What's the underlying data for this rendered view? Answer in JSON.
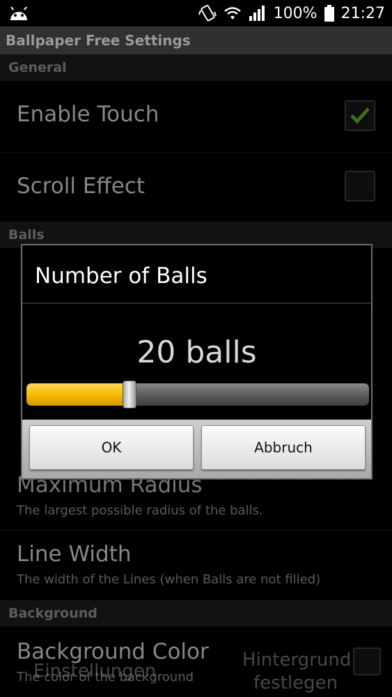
{
  "status_bar": {
    "battery": "100%",
    "time": "21:27"
  },
  "title_bar": {
    "title": "Ballpaper Free Settings"
  },
  "sections": {
    "general": "General",
    "balls": "Balls",
    "background": "Background"
  },
  "settings": {
    "enable_touch": {
      "title": "Enable Touch",
      "checked": true
    },
    "scroll_effect": {
      "title": "Scroll Effect",
      "checked": false
    },
    "maximum_radius": {
      "title": "Maximum Radius",
      "subtitle": "The largest possible radius of the balls."
    },
    "line_width": {
      "title": "Line Width",
      "subtitle": "The width of the Lines (when Balls are not filled)"
    },
    "background_color": {
      "title": "Background Color",
      "subtitle": "The color of the background"
    }
  },
  "overlay_buttons": {
    "settings": "Einstellungen",
    "set_background_line1": "Hintergrund",
    "set_background_line2": "festlegen"
  },
  "dialog": {
    "title": "Number of Balls",
    "value_text": "20 balls",
    "slider_level": 0.3,
    "ok_label": "OK",
    "cancel_label": "Abbruch"
  },
  "colors": {
    "accent": "#f5b800",
    "check": "#5fae20"
  }
}
